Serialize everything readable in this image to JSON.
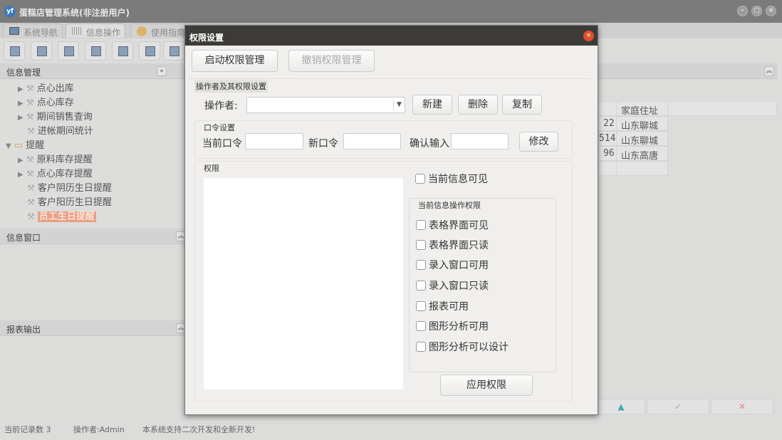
{
  "app": {
    "title": "蛋糕店管理系统(非注册用户)",
    "logo": "yf"
  },
  "tabs": [
    {
      "label": "系统导航"
    },
    {
      "label": "信息操作"
    },
    {
      "label": "使用指南"
    }
  ],
  "left": {
    "panel1": "信息管理",
    "tree": [
      "点心出库",
      "点心库存",
      "期间销售查询",
      "进帐期间统计",
      "提醒",
      "原料库存提醒",
      "点心库存提醒",
      "客户阴历生日提醒",
      "客户阳历生日提醒",
      "员工生日提醒"
    ],
    "panel2": "信息窗口",
    "panel3": "报表输出"
  },
  "table": {
    "headers": [
      "",
      "家庭住址",
      ""
    ],
    "rows": [
      [
        "22",
        "山东聊城"
      ],
      [
        "514",
        "山东聊城"
      ],
      [
        "96",
        "山东高唐"
      ]
    ]
  },
  "bottom_buttons": [
    "▲",
    "✓",
    "✕"
  ],
  "status": {
    "records": "当前记录数 3",
    "operator": "操作者:Admin",
    "note": "本系统支持二次开发和全新开发!"
  },
  "dialog": {
    "title": "权限设置",
    "close": "×",
    "start": "启动权限管理",
    "revoke": "撤销权限管理",
    "group1": "操作者及其权限设置",
    "operator_label": "操作者:",
    "operator_value": "",
    "new": "新建",
    "delete": "删除",
    "copy": "复制",
    "pwd_group": "口令设置",
    "cur_pwd": "当前口令",
    "new_pwd": "新口令",
    "confirm": "确认输入",
    "modify": "修改",
    "perm_group": "权限",
    "visible": "当前信息可见",
    "ops_group": "当前信息操作权限",
    "checks": [
      "表格界面可见",
      "表格界面只读",
      "录入窗口可用",
      "录入窗口只读",
      "报表可用",
      "图形分析可用",
      "图形分析可以设计"
    ],
    "apply": "应用权限"
  }
}
